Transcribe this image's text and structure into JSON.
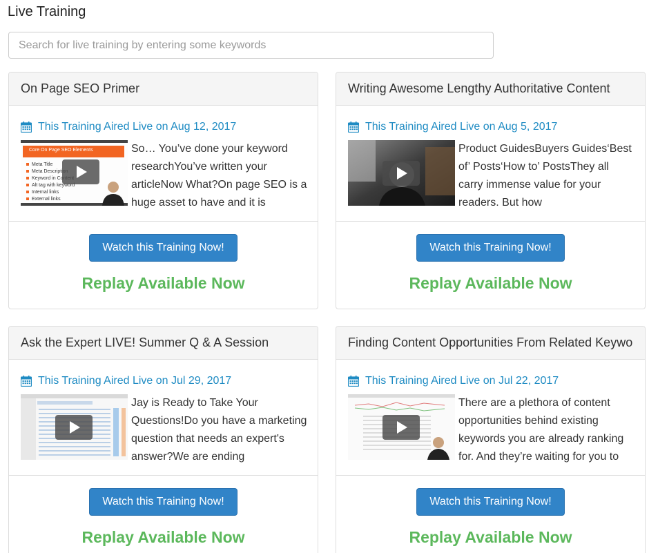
{
  "page": {
    "title": "Live Training"
  },
  "search": {
    "placeholder": "Search for live training by entering some keywords"
  },
  "colors": {
    "link": "#1e8bc3",
    "button": "#3184c8",
    "replay": "#5cb85c"
  },
  "trainings": [
    {
      "title": "On Page SEO Primer",
      "aired": "This Training Aired Live on Aug 12, 2017",
      "excerpt": "So… You’ve done your keyword researchYou’ve written your articleNow What?On page SEO is a huge asset to have and it is",
      "thumb_text": {
        "heading": "Core On Page SEO Elements",
        "items": [
          "Meta Title",
          "Meta Description",
          "Keyword in Content",
          "Alt tag with keyword",
          "Internal links",
          "External links"
        ]
      },
      "watch_label": "Watch this Training Now!",
      "replay_label": "Replay Available Now"
    },
    {
      "title": "Writing Awesome Lengthy Authoritative Content",
      "aired": "This Training Aired Live on Aug 5, 2017",
      "excerpt": "Product GuidesBuyers Guides‘Best of’ Posts‘How to’ PostsThey all carry immense value for your readers. But how",
      "watch_label": "Watch this Training Now!",
      "replay_label": "Replay Available Now"
    },
    {
      "title": "Ask the Expert LIVE! Summer Q & A Session",
      "aired": "This Training Aired Live on Jul 29, 2017",
      "excerpt": "Jay is Ready to Take Your Questions!Do you have a marketing question that needs an expert's answer?We are ending",
      "watch_label": "Watch this Training Now!",
      "replay_label": "Replay Available Now"
    },
    {
      "title": "Finding Content Opportunities From Related Keywords",
      "aired": "This Training Aired Live on Jul 22, 2017",
      "excerpt": "There are a plethora of content opportunities behind existing keywords you are already ranking for. And they’re waiting for you to",
      "watch_label": "Watch this Training Now!",
      "replay_label": "Replay Available Now"
    }
  ]
}
